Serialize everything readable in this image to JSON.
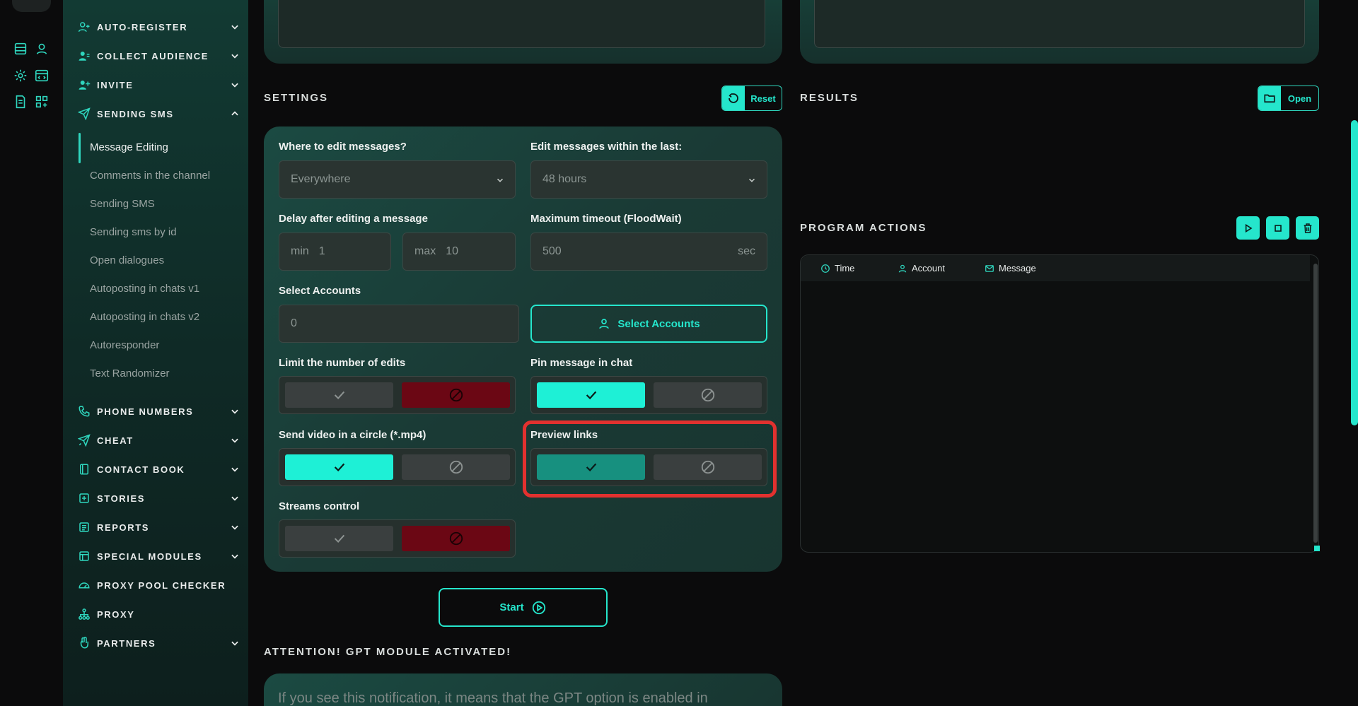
{
  "sidebar": {
    "sections_top": [
      {
        "label": "AUTO-REGISTER",
        "icon": "user-plus-icon"
      },
      {
        "label": "COLLECT AUDIENCE",
        "icon": "users-icon"
      },
      {
        "label": "INVITE",
        "icon": "user-add-icon"
      },
      {
        "label": "SENDING SMS",
        "icon": "send-icon"
      }
    ],
    "sms_items": [
      "Message Editing",
      "Comments in the channel",
      "Sending SMS",
      "Sending sms by id",
      "Open dialogues",
      "Autoposting in chats v1",
      "Autoposting in chats v2",
      "Autoresponder",
      "Text Randomizer"
    ],
    "sections_bottom": [
      {
        "label": "PHONE NUMBERS",
        "icon": "phone-icon"
      },
      {
        "label": "CHEAT",
        "icon": "rocket-icon"
      },
      {
        "label": "CONTACT BOOK",
        "icon": "book-icon"
      },
      {
        "label": "STORIES",
        "icon": "plus-square-icon"
      },
      {
        "label": "REPORTS",
        "icon": "report-icon"
      },
      {
        "label": "SPECIAL MODULES",
        "icon": "modules-icon"
      },
      {
        "label": "PROXY POOL CHECKER",
        "icon": "gauge-icon"
      },
      {
        "label": "PROXY",
        "icon": "network-icon"
      },
      {
        "label": "PARTNERS",
        "icon": "hand-icon"
      }
    ]
  },
  "settings": {
    "title": "SETTINGS",
    "reset_label": "Reset",
    "where_label": "Where to edit messages?",
    "where_value": "Everywhere",
    "within_label": "Edit messages within the last:",
    "within_value": "48 hours",
    "delay_label": "Delay after editing a message",
    "delay_min_prefix": "min",
    "delay_min": "1",
    "delay_max_prefix": "max",
    "delay_max": "10",
    "timeout_label": "Maximum timeout (FloodWait)",
    "timeout_value": "500",
    "timeout_unit": "sec",
    "accounts_label": "Select Accounts",
    "accounts_value": "0",
    "select_accounts_button": "Select Accounts",
    "limit_label": "Limit the number of edits",
    "pin_label": "Pin message in chat",
    "video_label": "Send video in a circle (*.mp4)",
    "preview_label": "Preview links",
    "streams_label": "Streams control"
  },
  "start_label": "Start",
  "gpt": {
    "title": "ATTENTION! GPT MODULE ACTIVATED!",
    "text": "If you see this notification, it means that the GPT option is enabled in"
  },
  "results": {
    "title": "RESULTS",
    "open_label": "Open"
  },
  "program_actions": {
    "title": "PROGRAM ACTIONS",
    "columns": [
      "Time",
      "Account",
      "Message"
    ]
  },
  "colors": {
    "accent": "#25e6cc",
    "danger": "#6b0714",
    "highlight": "#e2312f"
  }
}
